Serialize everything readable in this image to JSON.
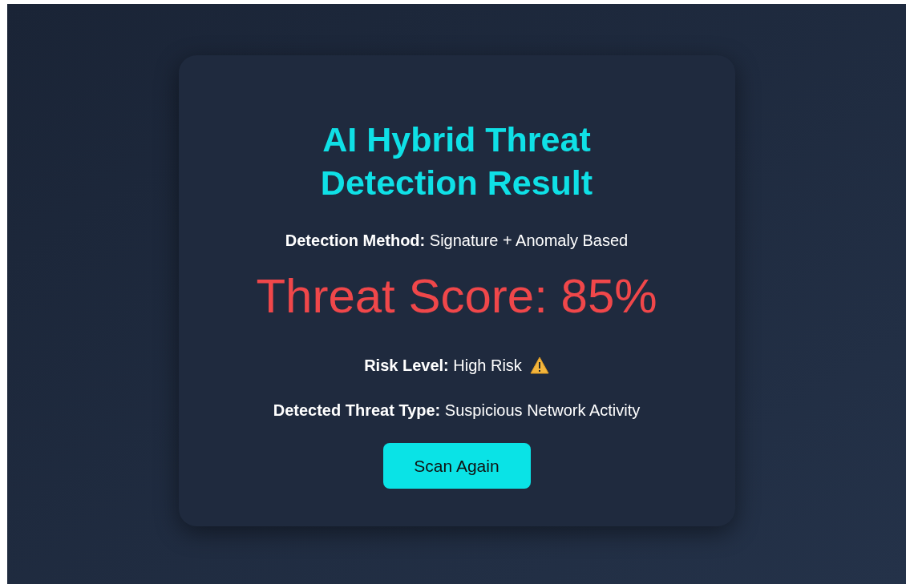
{
  "title": "AI Hybrid Threat Detection Result",
  "method": "**Detection Method:** Signature + Anomaly Based",
  "score": "Threat Score: 85%",
  "details": [
    {
      "text": "**Risk Level:** High Risk",
      "kind": "warning"
    },
    {
      "text": "**Detected Threat Type:** Suspicious Network Activity",
      "kind": "plain"
    }
  ],
  "button": "Scan Again"
}
